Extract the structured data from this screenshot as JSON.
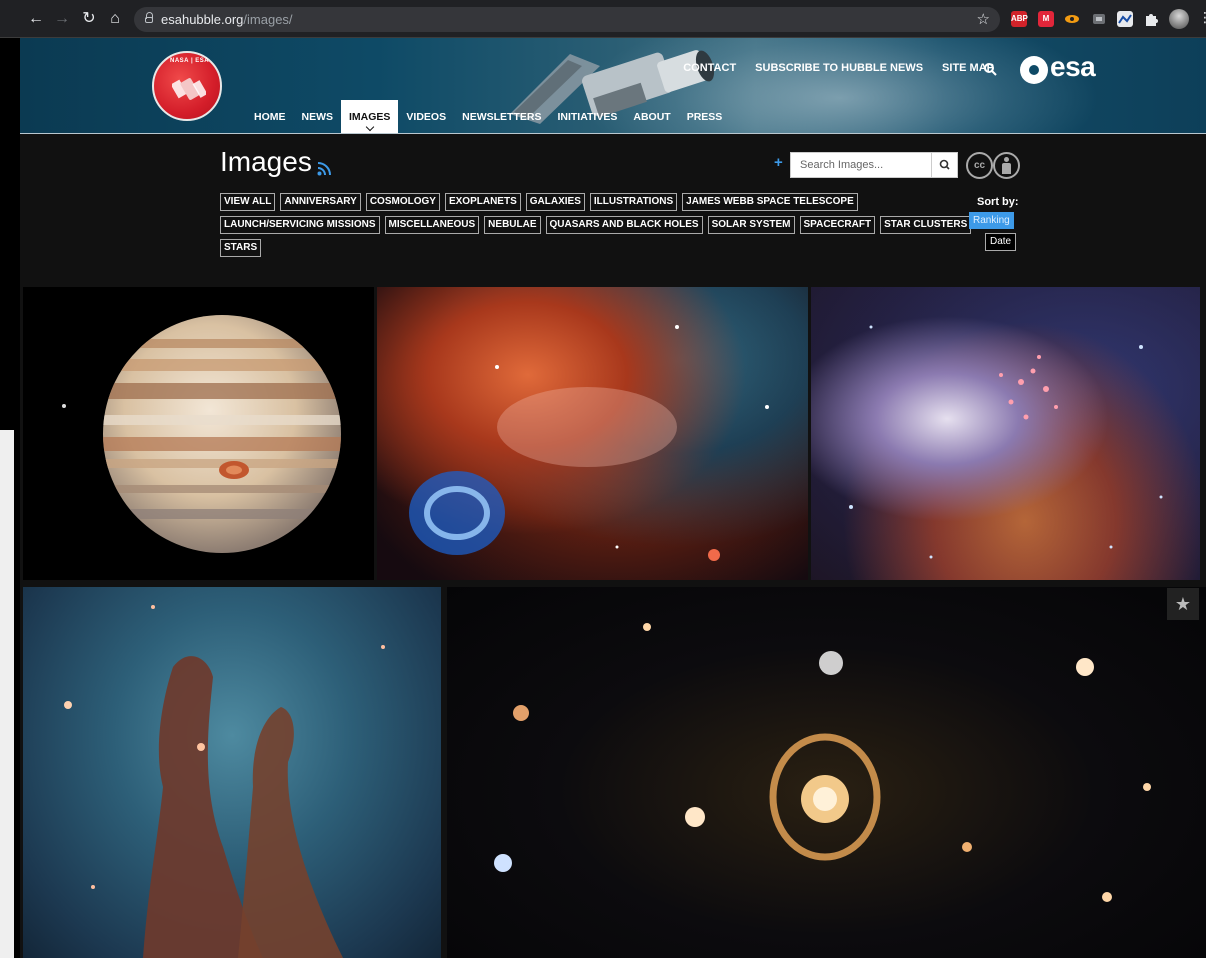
{
  "browser": {
    "url_domain": "esahubble.org",
    "url_path": "/images/",
    "extensions": [
      {
        "name": "adblock-plus-icon",
        "label": "ABP",
        "color": "#d2232a"
      },
      {
        "name": "extension-red-icon",
        "label": "M",
        "color": "#e2263a"
      },
      {
        "name": "extension-eye-icon",
        "label": "",
        "color": "#f29b12"
      },
      {
        "name": "extension-gray-icon",
        "label": "",
        "color": "#6c6f74"
      },
      {
        "name": "extension-chart-icon",
        "label": "",
        "color": "#e8eaed"
      },
      {
        "name": "extensions-puzzle-icon",
        "label": "",
        "color": "#e8eaed"
      },
      {
        "name": "profile-avatar-icon",
        "label": "",
        "color": "#8a8a8a"
      }
    ]
  },
  "header": {
    "logo_text": "NASA | ESA",
    "top_links": [
      "CONTACT",
      "SUBSCRIBE TO HUBBLE NEWS",
      "SITE MAP"
    ],
    "esa_logo": "esa",
    "nav": [
      {
        "label": "HOME",
        "active": false
      },
      {
        "label": "NEWS",
        "active": false
      },
      {
        "label": "IMAGES",
        "active": true
      },
      {
        "label": "VIDEOS",
        "active": false
      },
      {
        "label": "NEWSLETTERS",
        "active": false
      },
      {
        "label": "INITIATIVES",
        "active": false
      },
      {
        "label": "ABOUT",
        "active": false
      },
      {
        "label": "PRESS",
        "active": false
      }
    ]
  },
  "main": {
    "title": "Images",
    "search_placeholder": "Search Images...",
    "cc_label": "cc",
    "tag_rows": [
      [
        "VIEW ALL",
        "ANNIVERSARY",
        "COSMOLOGY",
        "EXOPLANETS",
        "GALAXIES",
        "ILLUSTRATIONS",
        "JAMES WEBB SPACE TELESCOPE"
      ],
      [
        "LAUNCH/SERVICING MISSIONS",
        "MISCELLANEOUS",
        "NEBULAE",
        "QUASARS AND BLACK HOLES",
        "SOLAR SYSTEM",
        "SPACECRAFT",
        "STAR CLUSTERS"
      ],
      [
        "STARS"
      ]
    ],
    "sort": {
      "label": "Sort by:",
      "options": [
        "Ranking",
        "Date"
      ],
      "selected": "Ranking"
    }
  },
  "gallery": [
    {
      "name": "gallery-image-jupiter"
    },
    {
      "name": "gallery-image-nebula-red"
    },
    {
      "name": "gallery-image-westerlund-cluster"
    },
    {
      "name": "gallery-image-pillars-of-creation"
    },
    {
      "name": "gallery-image-einstein-ring"
    }
  ],
  "colors": {
    "accent_blue": "#3d9ae8",
    "header_teal": "#0e4a66",
    "page_bg": "#111111"
  }
}
